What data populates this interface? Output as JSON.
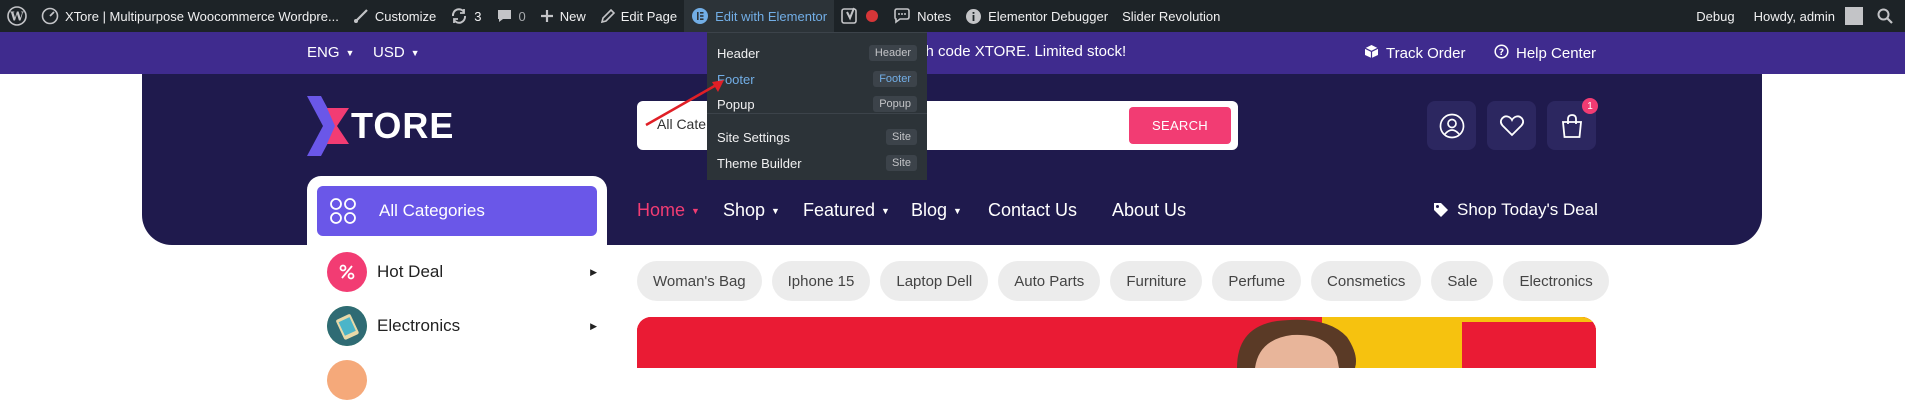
{
  "admin_bar": {
    "site_name": "XTore | Multipurpose Woocommerce Wordpre...",
    "customize": "Customize",
    "updates_count": "3",
    "comments_count": "0",
    "new": "New",
    "edit_page": "Edit Page",
    "edit_elementor": "Edit with Elementor",
    "notes": "Notes",
    "debugger": "Elementor Debugger",
    "slider": "Slider Revolution",
    "debug": "Debug",
    "howdy": "Howdy, admin"
  },
  "elementor_menu": {
    "items": [
      {
        "label": "Header",
        "badge": "Header"
      },
      {
        "label": "Footer",
        "badge": "Footer"
      },
      {
        "label": "Popup",
        "badge": "Popup"
      },
      {
        "label": "Site Settings",
        "badge": "Site"
      },
      {
        "label": "Theme Builder",
        "badge": "Site"
      }
    ]
  },
  "topbar": {
    "language": "ENG",
    "currency": "USD",
    "promo": "ch code XTORE. Limited stock!",
    "track_order": "Track Order",
    "help_center": "Help Center"
  },
  "header": {
    "logo_text": "TORE",
    "search_category": "All Cate",
    "search_button": "SEARCH",
    "cart_count": "1"
  },
  "nav": {
    "items": [
      "Home",
      "Shop",
      "Featured",
      "Blog",
      "Contact Us",
      "About Us"
    ],
    "deal": "Shop Today's Deal"
  },
  "categories": {
    "title": "All Categories",
    "items": [
      "Hot Deal",
      "Electronics"
    ]
  },
  "tags": [
    "Woman's Bag",
    "Iphone 15",
    "Laptop Dell",
    "Auto Parts",
    "Furniture",
    "Perfume",
    "Consmetics",
    "Sale",
    "Electronics"
  ],
  "colors": {
    "admin_bar": "#1d2327",
    "topbar": "#3f2b8e",
    "header": "#1f1a4d",
    "accent_pink": "#f23c73",
    "accent_purple": "#6a57e8",
    "hero_red": "#ea1b34"
  }
}
